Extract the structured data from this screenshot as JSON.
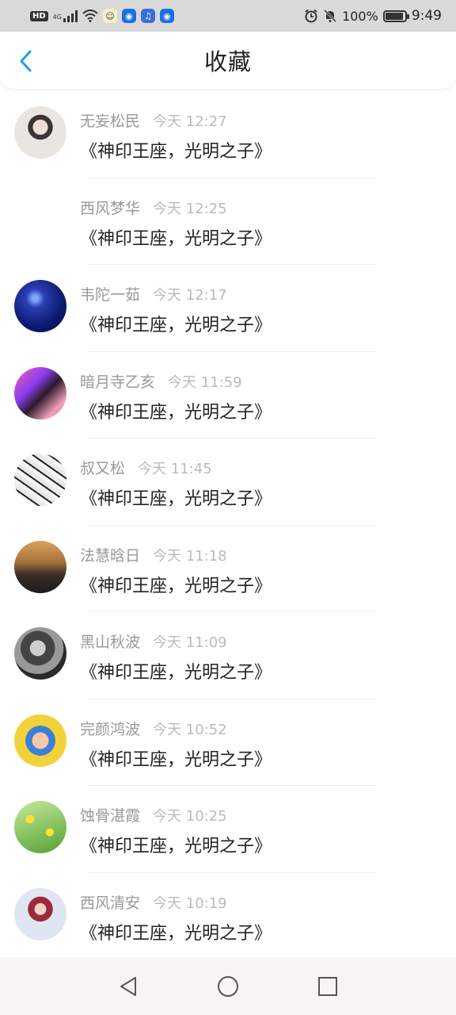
{
  "status_bar": {
    "network": "HD",
    "signal_type": "4G",
    "battery_pct": "100%",
    "battery_level": 1.0,
    "time": "9:49"
  },
  "header": {
    "title": "收藏",
    "accent_color": "#1aa3e6"
  },
  "items": [
    {
      "name": "无妄松民",
      "time": "今天 12:27",
      "book": "《神印王座，光明之子》",
      "avatar": "photo-girl"
    },
    {
      "name": "西风梦华",
      "time": "今天 12:25",
      "book": "《神印王座，光明之子》",
      "avatar": "none"
    },
    {
      "name": "韦陀一茹",
      "time": "今天 12:17",
      "book": "《神印王座，光明之子》",
      "avatar": "galaxy"
    },
    {
      "name": "暗月寺乙亥",
      "time": "今天 11:59",
      "book": "《神印王座，光明之子》",
      "avatar": "neon-girl"
    },
    {
      "name": "叔又松",
      "time": "今天 11:45",
      "book": "《神印王座，光明之子》",
      "avatar": "manga-sketch"
    },
    {
      "name": "法慧晗日",
      "time": "今天 11:18",
      "book": "《神印王座，光明之子》",
      "avatar": "sunset-person"
    },
    {
      "name": "黑山秋波",
      "time": "今天 11:09",
      "book": "《神印王座，光明之子》",
      "avatar": "bw-portrait"
    },
    {
      "name": "完颜鸿波",
      "time": "今天 10:52",
      "book": "《神印王座，光明之子》",
      "avatar": "baby-pool"
    },
    {
      "name": "蚀骨湛霞",
      "time": "今天 10:25",
      "book": "《神印王座，光明之子》",
      "avatar": "yellow-flowers"
    },
    {
      "name": "西风清安",
      "time": "今天 10:19",
      "book": "《神印王座，光明之子》",
      "avatar": "girl-outdoor"
    }
  ]
}
